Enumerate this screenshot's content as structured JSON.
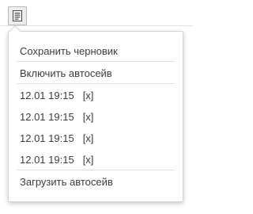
{
  "toolbar": {
    "button_icon": "document-list-icon"
  },
  "menu": {
    "save_draft": "Сохранить черновик",
    "enable_autosave": "Включить автосейв",
    "autosaves": [
      {
        "time": "12.01 19:15",
        "delete_label": "[x]"
      },
      {
        "time": "12.01 19:15",
        "delete_label": "[x]"
      },
      {
        "time": "12.01 19:15",
        "delete_label": "[x]"
      },
      {
        "time": "12.01 19:15",
        "delete_label": "[x]"
      }
    ],
    "load_autosave": "Загрузить автосейв"
  }
}
